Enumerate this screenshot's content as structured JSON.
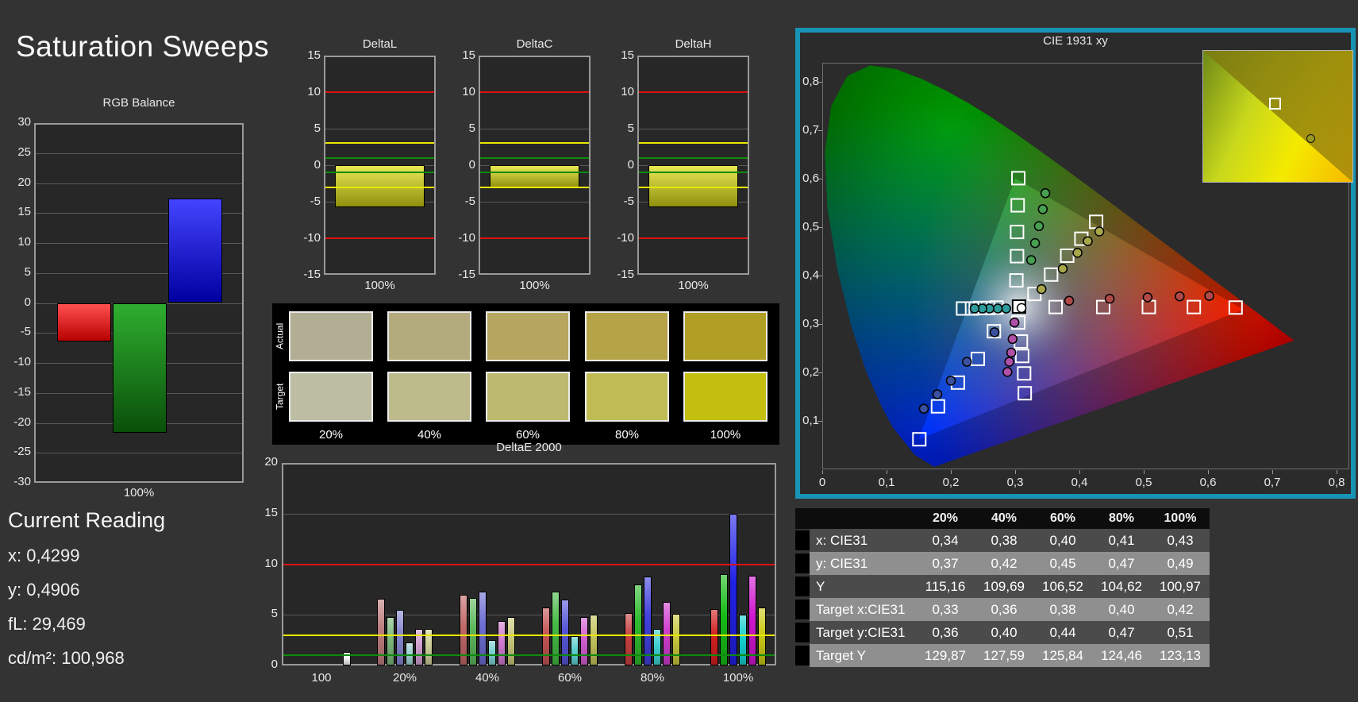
{
  "app": {
    "title": "Saturation Sweeps"
  },
  "colors": {
    "background": "#333333",
    "plot_bg": "#272727",
    "panel_border": "#9a9a9a",
    "grid": "#5a5a5a",
    "limit_red": "#dd1111",
    "limit_yellow": "#e8e800",
    "limit_green": "#0d8a0d",
    "cie_panel_border": "#1793b5",
    "swatch_panel_bg": "#000000",
    "text": "#e8e8e8"
  },
  "current_reading": {
    "heading": "Current Reading",
    "lines": [
      "x: 0,4299",
      "y: 0,4906",
      "fL: 29,469",
      "cd/m²: 100,968"
    ]
  },
  "swatch_panel": {
    "row_labels": [
      "Actual",
      "Target"
    ],
    "col_labels": [
      "20%",
      "40%",
      "60%",
      "80%",
      "100%"
    ],
    "actual_colors": [
      "#b2ae93",
      "#b3aa7d",
      "#b7a65f",
      "#b5a347",
      "#b19e24"
    ],
    "target_colors": [
      "#bcbda3",
      "#bdbb8c",
      "#bdba70",
      "#c0bc55",
      "#c2bf10"
    ]
  },
  "table": {
    "headers": [
      "",
      "",
      "20%",
      "40%",
      "60%",
      "80%",
      "100%"
    ],
    "rows": [
      {
        "label": "x: CIE31",
        "values": [
          "0,34",
          "0,38",
          "0,40",
          "0,41",
          "0,43"
        ]
      },
      {
        "label": "y: CIE31",
        "values": [
          "0,37",
          "0,42",
          "0,45",
          "0,47",
          "0,49"
        ]
      },
      {
        "label": "Y",
        "values": [
          "115,16",
          "109,69",
          "106,52",
          "104,62",
          "100,97"
        ]
      },
      {
        "label": "Target x:CIE31",
        "values": [
          "0,33",
          "0,36",
          "0,38",
          "0,40",
          "0,42"
        ]
      },
      {
        "label": "Target y:CIE31",
        "values": [
          "0,36",
          "0,40",
          "0,44",
          "0,47",
          "0,51"
        ]
      },
      {
        "label": "Target Y",
        "values": [
          "129,87",
          "127,59",
          "125,84",
          "124,46",
          "123,13"
        ]
      }
    ]
  },
  "chart_data": [
    {
      "id": "rgb_balance",
      "type": "bar",
      "title": "RGB Balance",
      "categories": [
        "Red",
        "Green",
        "Blue"
      ],
      "values": [
        -6.4,
        -21.6,
        17.4
      ],
      "bar_gradients": [
        [
          "#ff5050",
          "#b80000"
        ],
        [
          "#2fae2f",
          "#0a4f0a"
        ],
        [
          "#4444ff",
          "#0000a0"
        ]
      ],
      "yticks": [
        30,
        25,
        20,
        15,
        10,
        5,
        0,
        -5,
        -10,
        -15,
        -20,
        -25,
        -30
      ],
      "ylim": [
        -30,
        30
      ],
      "xlabel": "100%"
    },
    {
      "id": "deltaL",
      "type": "bar",
      "title": "DeltaL",
      "categories": [
        "100%"
      ],
      "values": [
        -5.8
      ],
      "bar_gradient": [
        "#e9e955",
        "#8f8f0e"
      ],
      "yticks": [
        15,
        10,
        5,
        0,
        -5,
        -10,
        -15
      ],
      "ylim": [
        -15,
        15
      ],
      "limit_lines": [
        [
          10,
          "#dd1111"
        ],
        [
          3,
          "#e8e800"
        ],
        [
          1,
          "#0d8a0d"
        ],
        [
          -1,
          "#0d8a0d"
        ],
        [
          -3,
          "#e8e800"
        ],
        [
          -10,
          "#dd1111"
        ]
      ],
      "xlabel": "100%"
    },
    {
      "id": "deltaC",
      "type": "bar",
      "title": "DeltaC",
      "categories": [
        "100%"
      ],
      "values": [
        -3.1
      ],
      "bar_gradient": [
        "#e9e955",
        "#8f8f0e"
      ],
      "yticks": [
        15,
        10,
        5,
        0,
        -5,
        -10,
        -15
      ],
      "ylim": [
        -15,
        15
      ],
      "limit_lines": [
        [
          10,
          "#dd1111"
        ],
        [
          3,
          "#e8e800"
        ],
        [
          1,
          "#0d8a0d"
        ],
        [
          -1,
          "#0d8a0d"
        ],
        [
          -3,
          "#e8e800"
        ],
        [
          -10,
          "#dd1111"
        ]
      ],
      "xlabel": "100%"
    },
    {
      "id": "deltaH",
      "type": "bar",
      "title": "DeltaH",
      "categories": [
        "100%"
      ],
      "values": [
        -5.8
      ],
      "bar_gradient": [
        "#e9e955",
        "#8f8f0e"
      ],
      "yticks": [
        15,
        10,
        5,
        0,
        -5,
        -10,
        -15
      ],
      "ylim": [
        -15,
        15
      ],
      "limit_lines": [
        [
          10,
          "#dd1111"
        ],
        [
          3,
          "#e8e800"
        ],
        [
          1,
          "#0d8a0d"
        ],
        [
          -1,
          "#0d8a0d"
        ],
        [
          -3,
          "#e8e800"
        ],
        [
          -10,
          "#dd1111"
        ]
      ],
      "xlabel": "100%"
    },
    {
      "id": "deltaE2000",
      "type": "bar",
      "title": "DeltaE 2000",
      "yticks": [
        20,
        15,
        10,
        5,
        0
      ],
      "ylim": [
        0,
        20
      ],
      "limit_lines": [
        [
          10,
          "#dd1111"
        ],
        [
          3,
          "#e8e800"
        ],
        [
          1,
          "#0d8a0d"
        ]
      ],
      "groups": [
        {
          "label": "100",
          "values": [
            1.3
          ],
          "colors": [
            "#f2f2f2"
          ]
        },
        {
          "label": "20%",
          "values": [
            6.6,
            4.8,
            5.5,
            2.3,
            3.6,
            3.6
          ],
          "colors": [
            "#bd7d7d",
            "#7cb87c",
            "#8585cf",
            "#9ed2d2",
            "#cf9ecf",
            "#cfcf9a"
          ]
        },
        {
          "label": "40%",
          "values": [
            7.0,
            6.7,
            7.3,
            2.5,
            4.4,
            4.8
          ],
          "colors": [
            "#c16868",
            "#5cb75c",
            "#6d6dd3",
            "#7cd0d0",
            "#d07cd0",
            "#c8c87a"
          ]
        },
        {
          "label": "60%",
          "values": [
            5.7,
            7.3,
            6.5,
            2.9,
            4.8,
            5.0
          ],
          "colors": [
            "#c45454",
            "#45ba45",
            "#5656d8",
            "#5ed0d0",
            "#d05ed0",
            "#c3c35c"
          ]
        },
        {
          "label": "80%",
          "values": [
            5.2,
            8.0,
            8.8,
            3.6,
            6.3,
            5.1
          ],
          "colors": [
            "#c84040",
            "#2ebb2e",
            "#4141dd",
            "#3ed0d0",
            "#d03ed0",
            "#c8c83e"
          ]
        },
        {
          "label": "100%",
          "values": [
            5.6,
            9.0,
            15.0,
            5.0,
            8.9,
            5.7
          ],
          "colors": [
            "#d32020",
            "#16bb16",
            "#2121e6",
            "#16d0d0",
            "#d016d0",
            "#c9c916"
          ]
        }
      ]
    },
    {
      "id": "cie",
      "type": "scatter",
      "title": "CIE 1931 xy",
      "xtick_labels": [
        "0",
        "0,1",
        "0,2",
        "0,3",
        "0,4",
        "0,5",
        "0,6",
        "0,7",
        "0,8"
      ],
      "ytick_labels": [
        "0,1",
        "0,2",
        "0,3",
        "0,4",
        "0,5",
        "0,6",
        "0,7",
        "0,8"
      ],
      "triangle": [
        [
          0.655,
          0.33
        ],
        [
          0.3,
          0.601
        ],
        [
          0.15,
          0.062
        ]
      ],
      "white_point": {
        "target": [
          0.306,
          0.336
        ],
        "measured": [
          0.31,
          0.333
        ]
      },
      "series": [
        {
          "name": "red",
          "color": "#b04848",
          "targets": [
            [
              0.363,
              0.335
            ],
            [
              0.437,
              0.335
            ],
            [
              0.508,
              0.335
            ],
            [
              0.578,
              0.335
            ],
            [
              0.643,
              0.334
            ]
          ],
          "measured": [
            [
              0.384,
              0.348
            ],
            [
              0.447,
              0.352
            ],
            [
              0.506,
              0.355
            ],
            [
              0.556,
              0.357
            ],
            [
              0.602,
              0.358
            ]
          ]
        },
        {
          "name": "yellow",
          "color": "#a8a84a",
          "targets": [
            [
              0.33,
              0.362
            ],
            [
              0.356,
              0.402
            ],
            [
              0.381,
              0.441
            ],
            [
              0.403,
              0.476
            ],
            [
              0.426,
              0.511
            ]
          ],
          "measured": [
            [
              0.341,
              0.372
            ],
            [
              0.374,
              0.414
            ],
            [
              0.397,
              0.447
            ],
            [
              0.413,
              0.471
            ],
            [
              0.431,
              0.491
            ]
          ]
        },
        {
          "name": "green",
          "color": "#46a050",
          "targets": [
            [
              0.302,
              0.39
            ],
            [
              0.303,
              0.44
            ],
            [
              0.303,
              0.49
            ],
            [
              0.304,
              0.545
            ],
            [
              0.305,
              0.601
            ]
          ],
          "measured": [
            [
              0.325,
              0.432
            ],
            [
              0.331,
              0.467
            ],
            [
              0.337,
              0.502
            ],
            [
              0.343,
              0.537
            ],
            [
              0.347,
              0.57
            ]
          ]
        },
        {
          "name": "cyan",
          "color": "#2f9c9c",
          "targets": [
            [
              0.271,
              0.334
            ],
            [
              0.258,
              0.333
            ],
            [
              0.246,
              0.333
            ],
            [
              0.233,
              0.332
            ],
            [
              0.219,
              0.332
            ]
          ],
          "measured": [
            [
              0.286,
              0.332
            ],
            [
              0.273,
              0.332
            ],
            [
              0.26,
              0.332
            ],
            [
              0.249,
              0.332
            ],
            [
              0.237,
              0.332
            ]
          ]
        },
        {
          "name": "magenta",
          "color": "#b050a8",
          "targets": [
            [
              0.305,
              0.303
            ],
            [
              0.309,
              0.264
            ],
            [
              0.311,
              0.234
            ],
            [
              0.314,
              0.198
            ],
            [
              0.315,
              0.157
            ]
          ],
          "measured": [
            [
              0.299,
              0.303
            ],
            [
              0.296,
              0.269
            ],
            [
              0.294,
              0.241
            ],
            [
              0.291,
              0.222
            ],
            [
              0.288,
              0.201
            ]
          ]
        },
        {
          "name": "blue",
          "color": "#3c50a0",
          "targets": [
            [
              0.267,
              0.285
            ],
            [
              0.242,
              0.228
            ],
            [
              0.211,
              0.179
            ],
            [
              0.18,
              0.13
            ],
            [
              0.151,
              0.062
            ]
          ],
          "measured": [
            [
              0.268,
              0.283
            ],
            [
              0.225,
              0.222
            ],
            [
              0.2,
              0.183
            ],
            [
              0.179,
              0.155
            ],
            [
              0.158,
              0.125
            ]
          ]
        }
      ],
      "inset": {
        "target_pos": [
          0.48,
          0.4
        ],
        "measured_pos": [
          0.71,
          0.66
        ],
        "measured_color": "#9a9a20"
      }
    }
  ]
}
